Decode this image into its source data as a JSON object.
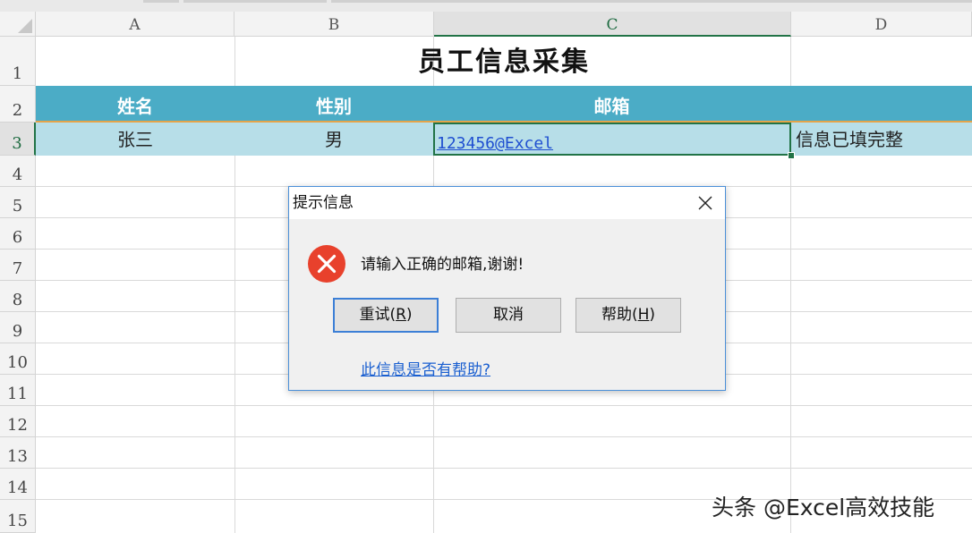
{
  "sheet": {
    "columns": [
      "A",
      "B",
      "C",
      "D"
    ],
    "selected_column": "C",
    "rows": [
      "1",
      "2",
      "3",
      "4",
      "5",
      "6",
      "7",
      "8",
      "9",
      "10",
      "11",
      "12",
      "13",
      "14",
      "15"
    ],
    "selected_row": "3",
    "title": "员工信息采集",
    "headers": [
      "姓名",
      "性别",
      "邮箱"
    ],
    "data_row": {
      "name": "张三",
      "gender": "男",
      "email": "123456@Excel",
      "status": "信息已填完整"
    },
    "colors": {
      "header_fill": "#4bacc6",
      "data_fill": "#b7dee8",
      "selection": "#217346",
      "header_underline": "#e4a44a"
    }
  },
  "dialog": {
    "title": "提示信息",
    "close_icon": "close-icon",
    "icon": "error-icon",
    "message": "请输入正确的邮箱,谢谢!",
    "buttons": {
      "retry_label": "重试(",
      "retry_key": "R",
      "retry_end": ")",
      "cancel_label": "取消",
      "help_label": "帮助(",
      "help_key": "H",
      "help_end": ")"
    },
    "help_link": "此信息是否有帮助?",
    "colors": {
      "error_red": "#e8412c",
      "link": "#1a5fd0",
      "focus_border": "#3c7fd6"
    }
  },
  "watermark": "头条 @Excel高效技能"
}
